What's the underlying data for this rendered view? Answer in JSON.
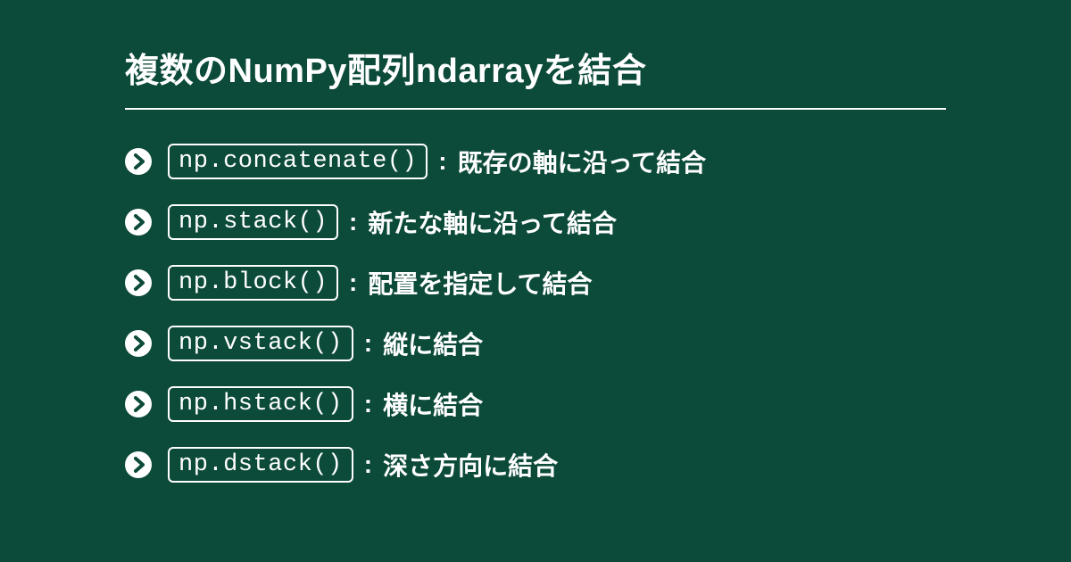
{
  "title": "複数のNumPy配列ndarrayを結合",
  "items": [
    {
      "code": "np.concatenate()",
      "desc": "既存の軸に沿って結合"
    },
    {
      "code": "np.stack()",
      "desc": "新たな軸に沿って結合"
    },
    {
      "code": "np.block()",
      "desc": "配置を指定して結合"
    },
    {
      "code": "np.vstack()",
      "desc": "縦に結合"
    },
    {
      "code": "np.hstack()",
      "desc": "横に結合"
    },
    {
      "code": "np.dstack()",
      "desc": "深さ方向に結合"
    }
  ],
  "separator": ":"
}
